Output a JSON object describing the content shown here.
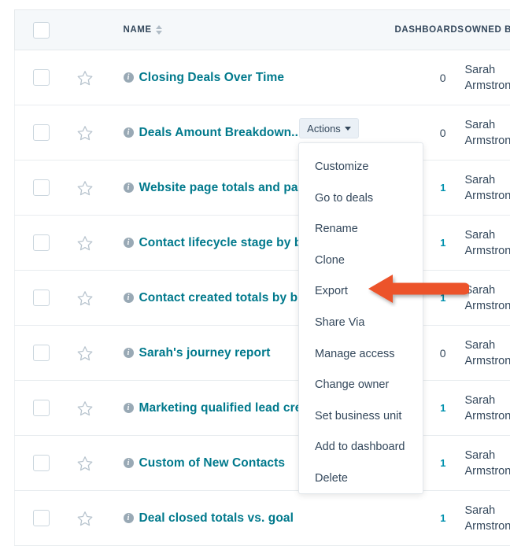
{
  "table": {
    "columns": {
      "name": "NAME",
      "dashboards": "DASHBOARDS",
      "owner": "OWNED BY"
    },
    "rows": [
      {
        "name": "Closing Deals Over Time",
        "dashboards": "0",
        "dashboards_linked": false,
        "owner_line1": "Sarah",
        "owner_line2": "Armstrong"
      },
      {
        "name": "Deals Amount Breakdown...",
        "dashboards": "0",
        "dashboards_linked": false,
        "owner_line1": "Sarah",
        "owner_line2": "Armstrong"
      },
      {
        "name": "Website page totals and page views",
        "dashboards": "1",
        "dashboards_linked": true,
        "owner_line1": "Sarah",
        "owner_line2": "Armstrong"
      },
      {
        "name": "Contact lifecycle stage by business unit",
        "dashboards": "1",
        "dashboards_linked": true,
        "owner_line1": "Sarah",
        "owner_line2": "Armstrong"
      },
      {
        "name": "Contact created totals by business unit",
        "dashboards": "1",
        "dashboards_linked": true,
        "owner_line1": "Sarah",
        "owner_line2": "Armstrong"
      },
      {
        "name": "Sarah's journey report",
        "dashboards": "0",
        "dashboards_linked": false,
        "owner_line1": "Sarah",
        "owner_line2": "Armstrong"
      },
      {
        "name": "Marketing qualified lead created totals",
        "dashboards": "1",
        "dashboards_linked": true,
        "owner_line1": "Sarah",
        "owner_line2": "Armstrong"
      },
      {
        "name": "Custom of New Contacts",
        "dashboards": "1",
        "dashboards_linked": true,
        "owner_line1": "Sarah",
        "owner_line2": "Armstrong"
      },
      {
        "name": "Deal closed totals vs. goal",
        "dashboards": "1",
        "dashboards_linked": true,
        "owner_line1": "Sarah",
        "owner_line2": "Armstrong"
      }
    ]
  },
  "actions_button": {
    "label": "Actions"
  },
  "actions_menu": {
    "items": [
      "Customize",
      "Go to deals",
      "Rename",
      "Clone",
      "Export",
      "Share Via",
      "Manage access",
      "Change owner",
      "Set business unit",
      "Add to dashboard",
      "Delete"
    ]
  },
  "annotation": {
    "target": "Export",
    "color": "#ec5329"
  },
  "colors": {
    "link": "#00798c",
    "accent": "#0091ae",
    "header_bg": "#f5f8fa",
    "text": "#33475b",
    "arrow": "#ec5329"
  }
}
